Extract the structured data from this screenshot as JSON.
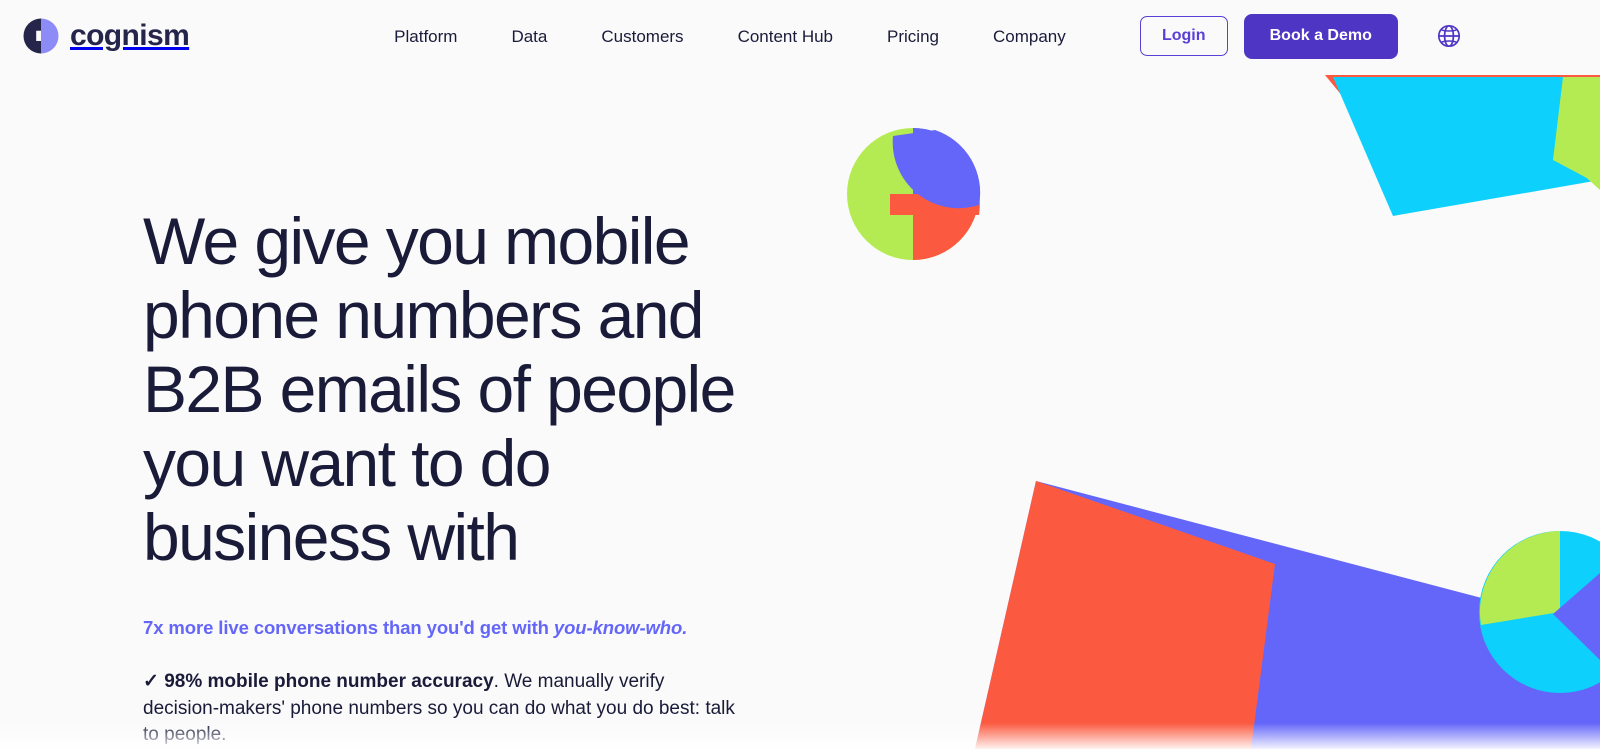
{
  "brand": {
    "name": "cognism",
    "logo_icon": "cognism-circle-logo",
    "logo_dark": "#25244B",
    "logo_light": "#8D8BF5"
  },
  "colors": {
    "background": "#FAFAFA",
    "navy": "#191B39",
    "purple": "#4F35C4",
    "purple_link": "#5B3FD6",
    "indigo": "#6466F9",
    "red": "#FB5A40",
    "cyan": "#0DD0FC",
    "green": "#B5EB52",
    "white": "#FFFFFF"
  },
  "header": {
    "nav_items": [
      {
        "label": "Platform"
      },
      {
        "label": "Data"
      },
      {
        "label": "Customers"
      },
      {
        "label": "Content Hub"
      },
      {
        "label": "Pricing"
      },
      {
        "label": "Company"
      }
    ],
    "login_label": "Login",
    "demo_label": "Book a Demo",
    "globe_icon": "globe-icon"
  },
  "hero": {
    "headline": "We give you mobile phone numbers and B2B emails of people you want to do business with",
    "subhead_plain": "7x more live conversations than you'd get with ",
    "subhead_italic": "you-know-who.",
    "bullet_check": "✓",
    "bullet_strong": "98% mobile phone number accuracy",
    "bullet_rest": ". We manually verify decision-makers' phone numbers so you can do what you do best: talk to people."
  },
  "decor": {
    "shapes": [
      {
        "name": "pie-circle-graphic",
        "colors": [
          "#B5EB52",
          "#6466F9",
          "#FB5A40"
        ]
      },
      {
        "name": "top-right-cyan-wedge",
        "colors": [
          "#0DD0FC",
          "#FB5A40",
          "#B5EB52"
        ]
      },
      {
        "name": "bottom-red-panel",
        "colors": [
          "#FB5A40"
        ]
      },
      {
        "name": "bottom-blue-panel",
        "colors": [
          "#6466F9"
        ]
      },
      {
        "name": "bottom-right-circle",
        "colors": [
          "#B5EB52",
          "#0DD0FC",
          "#6466F9"
        ]
      }
    ]
  }
}
